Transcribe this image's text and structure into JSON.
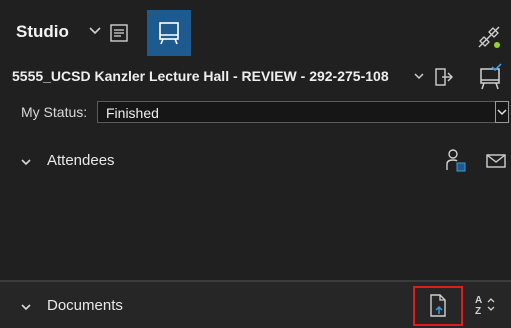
{
  "topbar": {
    "studio_label": "Studio",
    "icons": {
      "chevron": "chevron-down-icon",
      "list": "agenda-list-icon",
      "present": "presentation-screen-icon",
      "connect": "connection-status-icon"
    },
    "accent_color": "#1e5a8e",
    "status_dot_color": "#9bd12b"
  },
  "session": {
    "title": "5555_UCSD Kanzler Lecture Hall - REVIEW - 292-275-108",
    "icons": {
      "leave": "leave-session-icon",
      "checkin": "check-in-screen-icon"
    }
  },
  "status": {
    "label": "My Status:",
    "value": "Finished"
  },
  "attendees": {
    "title": "Attendees",
    "icons": {
      "add": "add-attendee-icon",
      "mail": "mail-icon"
    }
  },
  "documents": {
    "title": "Documents",
    "icons": {
      "upload": "upload-document-icon",
      "sort": "sort-az-icon"
    },
    "highlight_color": "#e01b1b"
  }
}
